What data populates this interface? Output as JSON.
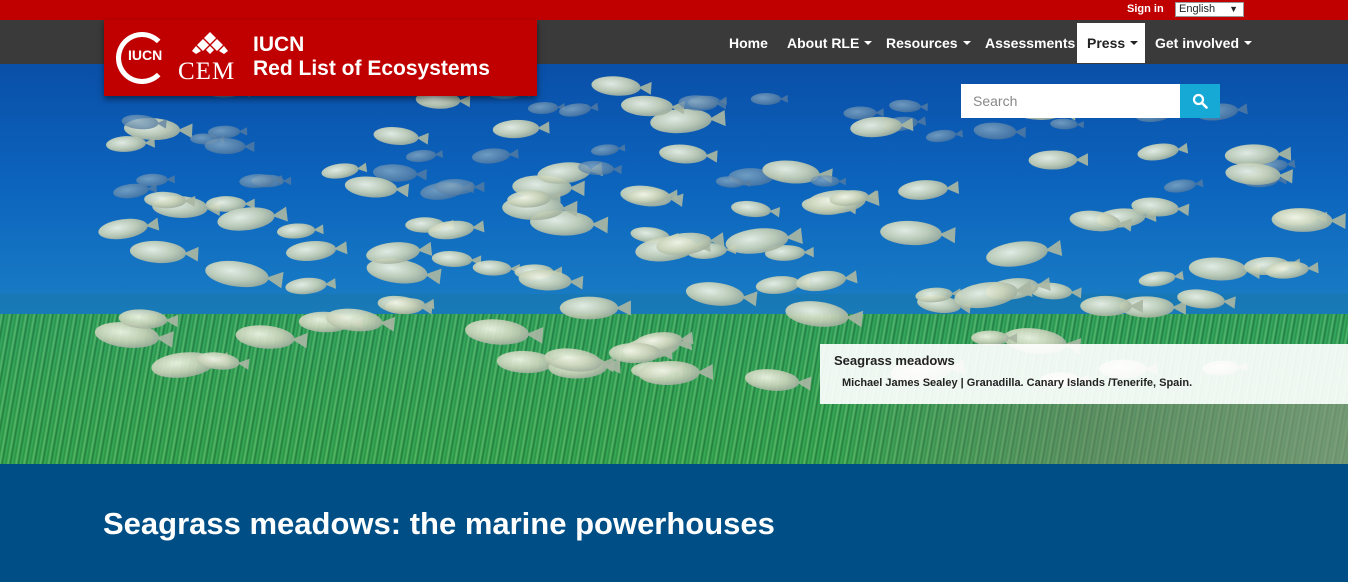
{
  "topbar": {
    "signin_label": "Sign in",
    "language": "English"
  },
  "logo": {
    "iucn": "IUCN",
    "cem": "CEM",
    "title_line1": "IUCN",
    "title_line2": "Red List of Ecosystems"
  },
  "nav": {
    "items": [
      {
        "label": "Home",
        "dropdown": false
      },
      {
        "label": "About RLE",
        "dropdown": true
      },
      {
        "label": "Resources",
        "dropdown": true
      },
      {
        "label": "Assessments",
        "dropdown": false
      },
      {
        "label": "Press",
        "dropdown": true,
        "active": true
      },
      {
        "label": "Get involved",
        "dropdown": true
      }
    ]
  },
  "search": {
    "placeholder": "Search",
    "icon": "search-icon"
  },
  "hero": {
    "caption_title": "Seagrass meadows",
    "caption_credit": "Michael James Sealey | Granadilla. Canary Islands /Tenerife, Spain."
  },
  "page": {
    "title": "Seagrass meadows: the marine powerhouses"
  },
  "colors": {
    "brand_red": "#c00000",
    "nav_dark": "#3a3a3a",
    "band_blue": "#004e86",
    "search_blue": "#17a9d6"
  }
}
